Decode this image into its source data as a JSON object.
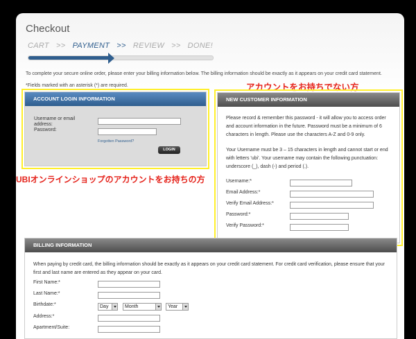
{
  "checkout": {
    "title": "Checkout",
    "steps": [
      "CART",
      "PAYMENT",
      "REVIEW",
      "DONE!"
    ],
    "separator": ">>",
    "active_step": "PAYMENT",
    "progress_fraction": 0.445,
    "intro": "To complete your secure online order, please enter your billing information below. The billing information should be exactly as it appears on your credit card statement.",
    "required_note": "*Fields marked with an asterisk (*) are required."
  },
  "annotations": {
    "new_customer": "アカウントをお持ちでない方",
    "login": "UBIオンラインショップのアカウントをお持ちの方",
    "highlight_color": "#ffef2a",
    "text_color": "#e5231b"
  },
  "login": {
    "header": "ACCOUNT LOGIN INFORMATION",
    "username_label": "Username or email address:",
    "password_label": "Password:",
    "forgot_link": "Forgotten Password?",
    "button": "LOGIN"
  },
  "new_customer": {
    "header": "NEW CUSTOMER INFORMATION",
    "para1": "Please record & remember this password - it will allow you to access order and account information in the future. Password must be a minimum of 6 characters in length. Please use the characters A-Z and 0-9 only.",
    "para2": "Your Username must be 3 – 15 characters in length and cannot start or end with letters 'ubi'. Your username may contain the following punctuation: underscore (_), dash (-) and period (.).",
    "fields": [
      "Username:*",
      "Email Address:*",
      "Verify Email Address:*",
      "Password:*",
      "Verify Password:*"
    ]
  },
  "billing": {
    "header": "BILLING INFORMATION",
    "note": "When paying by credit card, the billing information should be exactly as it appears on your credit card statement. For credit card verification, please ensure that your first and last name are entered as they appear on your card.",
    "fields": [
      "First Name:*",
      "Last Name:*",
      "Birthdate:*",
      "Address:*",
      "Apartment/Suite:"
    ],
    "birth_day": "Day",
    "birth_month": "Month",
    "birth_year": "Year"
  },
  "colors": {
    "accent_blue": "#2f5e8e",
    "panel_gray": "#4d4d4d"
  }
}
